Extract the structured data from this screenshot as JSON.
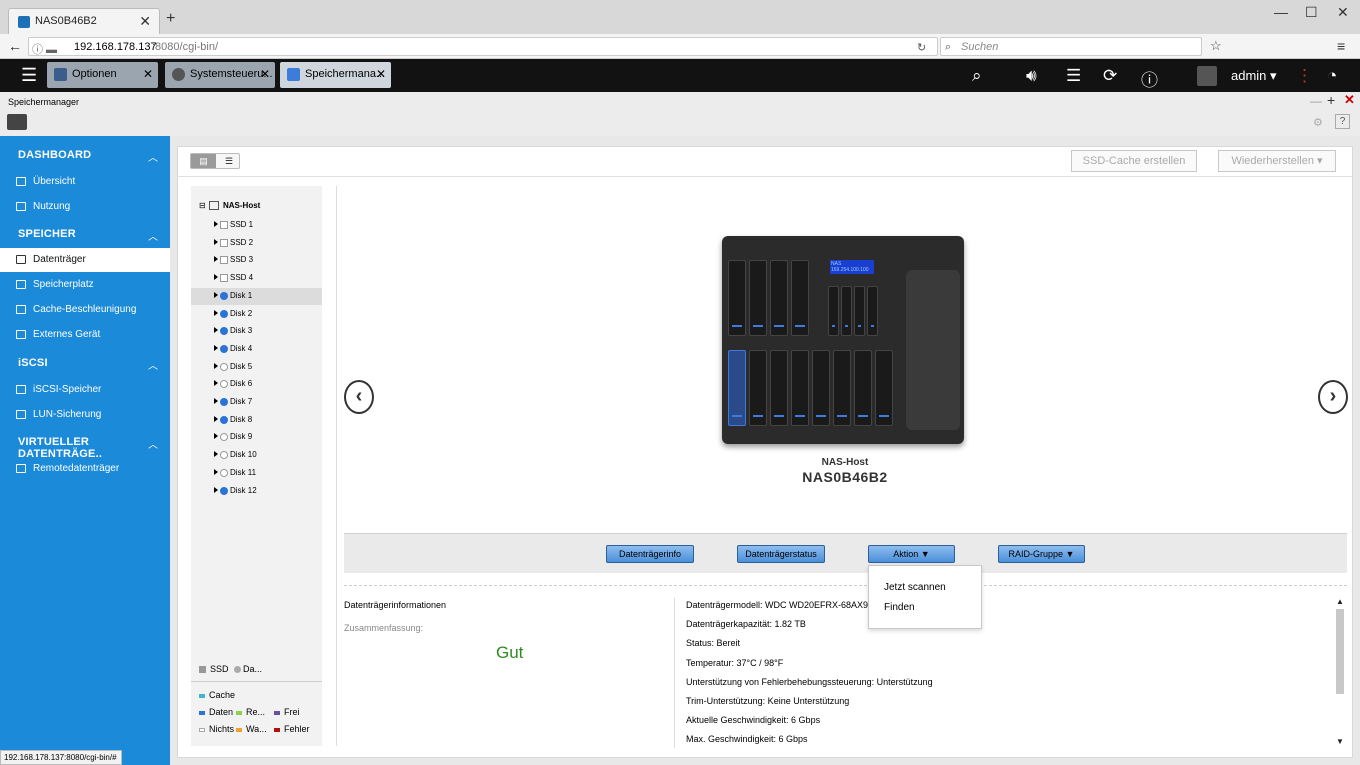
{
  "browser": {
    "tab_title": "NAS0B46B2",
    "url_host": "192.168.178.137",
    "url_rest": ":8080/cgi-bin/",
    "search_placeholder": "Suchen",
    "status_url": "192.168.178.137:8080/cgi-bin/#"
  },
  "qts_tabs": [
    {
      "label": "Optionen"
    },
    {
      "label": "Systemsteueru..."
    },
    {
      "label": "Speichermana..."
    }
  ],
  "topbar": {
    "user": "admin ▾"
  },
  "app": {
    "title": "Speichermanager"
  },
  "sidebar": {
    "dashboard": {
      "label": "DASHBOARD",
      "items": [
        "Übersicht",
        "Nutzung"
      ]
    },
    "speicher": {
      "label": "SPEICHER",
      "items": [
        "Datenträger",
        "Speicherplatz",
        "Cache-Beschleunigung",
        "Externes Gerät"
      ]
    },
    "iscsi": {
      "label": "iSCSI",
      "items": [
        "iSCSI-Speicher",
        "LUN-Sicherung"
      ]
    },
    "virtuell": {
      "label": "VIRTUELLER DATENTRÄGE..",
      "items": [
        "Remotedatenträger"
      ]
    }
  },
  "header_buttons": {
    "ssd_cache": "SSD-Cache erstellen",
    "restore": "Wiederherstellen ▾"
  },
  "tree": {
    "root": "NAS-Host",
    "nodes": [
      {
        "label": "SSD 1",
        "kind": "box"
      },
      {
        "label": "SSD 2",
        "kind": "box"
      },
      {
        "label": "SSD 3",
        "kind": "box"
      },
      {
        "label": "SSD 4",
        "kind": "box"
      },
      {
        "label": "Disk 1",
        "kind": "blue"
      },
      {
        "label": "Disk 2",
        "kind": "blue"
      },
      {
        "label": "Disk 3",
        "kind": "blue"
      },
      {
        "label": "Disk 4",
        "kind": "blue"
      },
      {
        "label": "Disk 5",
        "kind": "empty"
      },
      {
        "label": "Disk 6",
        "kind": "empty"
      },
      {
        "label": "Disk 7",
        "kind": "blue"
      },
      {
        "label": "Disk 8",
        "kind": "blue"
      },
      {
        "label": "Disk 9",
        "kind": "empty"
      },
      {
        "label": "Disk 10",
        "kind": "empty"
      },
      {
        "label": "Disk 11",
        "kind": "empty"
      },
      {
        "label": "Disk 12",
        "kind": "blue"
      }
    ],
    "selected": "Disk 1"
  },
  "legend": {
    "ssd": "SSD",
    "da": "Da...",
    "cache": "Cache",
    "daten": "Daten",
    "re": "Re...",
    "frei": "Frei",
    "nichts": "Nichts",
    "wa": "Wa...",
    "fehler": "Fehler",
    "colors": {
      "cache": "#3fb6c9",
      "daten": "#2b73d6",
      "re": "#8bd14a",
      "frei": "#6a4fa0",
      "nichts": "#dddddd",
      "wa": "#f0a030",
      "fehler": "#b01010"
    }
  },
  "device": {
    "type": "NAS-Host",
    "name": "NAS0B46B2",
    "lcd": "NAS 169.254.100.100"
  },
  "actions": {
    "info": "Datenträgerinfo",
    "status": "Datenträgerstatus",
    "aktion": "Aktion ▼",
    "raid": "RAID-Gruppe ▼",
    "menu": [
      "Jetzt scannen",
      "Finden"
    ]
  },
  "details": {
    "title": "Datenträgerinformationen",
    "summary_label": "Zusammenfassung:",
    "summary_value": "Gut",
    "lines": [
      "Datenträgermodell: WDC WD20EFRX-68AX9N0 (",
      "Datenträgerkapazität: 1.82 TB",
      "Status: Bereit",
      "Temperatur: 37°C / 98°F",
      "Unterstützung von Fehlerbehebungssteuerung: Unterstützung",
      "Trim-Unterstützung: Keine Unterstützung",
      "Aktuelle Geschwindigkeit: 6 Gbps",
      "Max. Geschwindigkeit: 6 Gbps"
    ]
  }
}
